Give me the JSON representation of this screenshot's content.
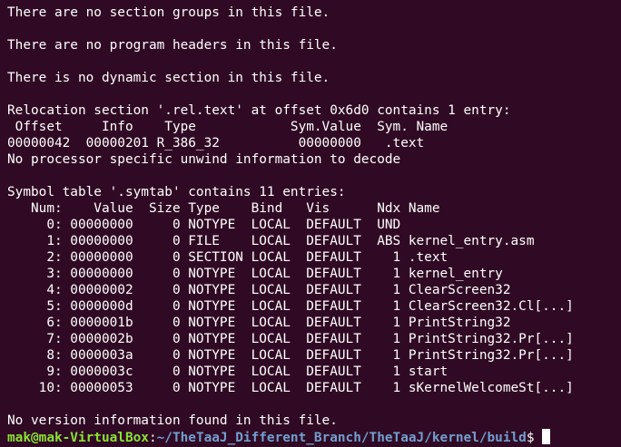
{
  "terminal": {
    "lines": [
      "There are no section groups in this file.",
      "",
      "There are no program headers in this file.",
      "",
      "There is no dynamic section in this file.",
      "",
      "Relocation section '.rel.text' at offset 0x6d0 contains 1 entry:",
      " Offset     Info    Type            Sym.Value  Sym. Name",
      "00000042  00000201 R_386_32          00000000   .text",
      "No processor specific unwind information to decode",
      "",
      "Symbol table '.symtab' contains 11 entries:",
      "   Num:    Value  Size Type    Bind   Vis      Ndx Name",
      "     0: 00000000     0 NOTYPE  LOCAL  DEFAULT  UND",
      "     1: 00000000     0 FILE    LOCAL  DEFAULT  ABS kernel_entry.asm",
      "     2: 00000000     0 SECTION LOCAL  DEFAULT    1 .text",
      "     3: 00000000     0 NOTYPE  LOCAL  DEFAULT    1 kernel_entry",
      "     4: 00000002     0 NOTYPE  LOCAL  DEFAULT    1 ClearScreen32",
      "     5: 0000000d     0 NOTYPE  LOCAL  DEFAULT    1 ClearScreen32.Cl[...]",
      "     6: 0000001b     0 NOTYPE  LOCAL  DEFAULT    1 PrintString32",
      "     7: 0000002b     0 NOTYPE  LOCAL  DEFAULT    1 PrintString32.Pr[...]",
      "     8: 0000003a     0 NOTYPE  LOCAL  DEFAULT    1 PrintString32.Pr[...]",
      "     9: 0000003c     0 NOTYPE  LOCAL  DEFAULT    1 start",
      "    10: 00000053     0 NOTYPE  LOCAL  DEFAULT    1 sKernelWelcomeSt[...]",
      "",
      "No version information found in this file."
    ],
    "prompt": {
      "user_host": "mak@mak-VirtualBox",
      "separator": ":",
      "path": "~/TheTaaJ_Different_Branch/TheTaaJ/kernel/build",
      "symbol": "$"
    }
  },
  "colors": {
    "background": "#300a24",
    "text": "#ffffff",
    "prompt_user": "#8ae234",
    "prompt_path": "#729fcf"
  }
}
